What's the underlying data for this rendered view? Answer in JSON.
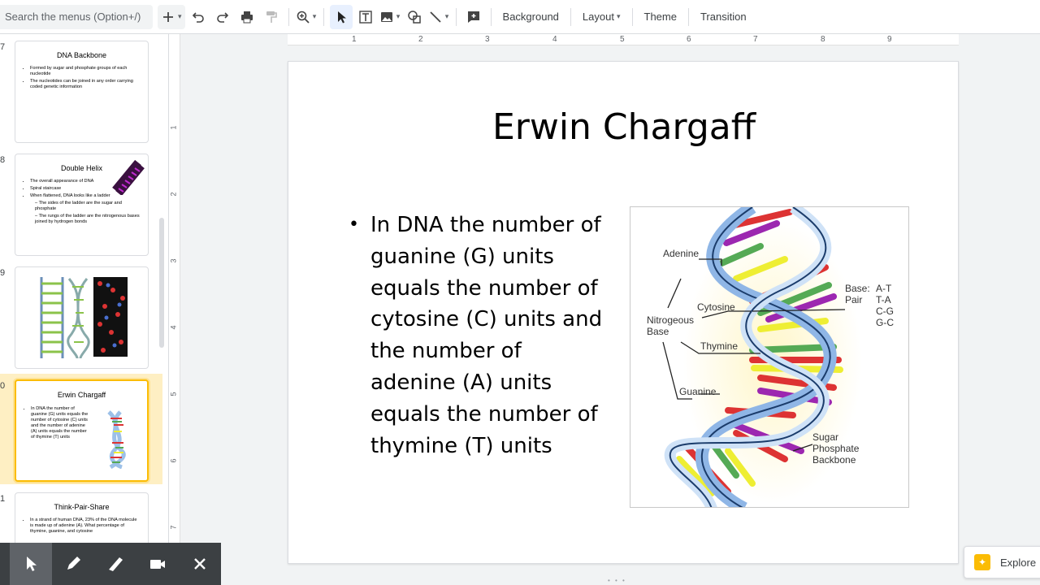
{
  "toolbar": {
    "search_placeholder": "Search the menus (Option+/)",
    "background_label": "Background",
    "layout_label": "Layout",
    "theme_label": "Theme",
    "transition_label": "Transition",
    "caret": "▾"
  },
  "filmstrip": {
    "slides": [
      {
        "num": "7",
        "title": "DNA Backbone",
        "bullets": [
          "Formed by sugar and phosphate groups of each nucleotide",
          "The nucleotides can be joined in any order carrying coded genetic information"
        ]
      },
      {
        "num": "8",
        "title": "Double Helix",
        "bullets": [
          "The overall appearance of DNA",
          "Spiral staircase",
          "When flattened, DNA looks like a ladder"
        ],
        "sub_bullets": [
          "– The sides of the ladder are the sugar and phosphate",
          "– The rungs of the ladder are the nitrogenous bases joined by hydrogen bonds"
        ]
      },
      {
        "num": "9",
        "title": "",
        "bullets": []
      },
      {
        "num": "0",
        "title": "Erwin Chargaff",
        "bullets": [
          "In DNA the number of guanine (G) units equals the number of cytosine (C) units and the number of adenine (A) units equals the number of thymine (T) units"
        ]
      },
      {
        "num": "1",
        "title": "Think-Pair-Share",
        "bullets": [
          "In a strand of human DNA, 23% of the DNA molecule is made up of adenine (A). What percentage of thymine, guanine, and cytosine"
        ]
      }
    ]
  },
  "rulers": {
    "horizontal": [
      "1",
      "2",
      "3",
      "4",
      "5",
      "6",
      "7",
      "8",
      "9"
    ],
    "vertical": [
      "1",
      "2",
      "3",
      "4",
      "5",
      "6",
      "7"
    ]
  },
  "slide": {
    "title": "Erwin Chargaff",
    "bullet_glyph": "•",
    "body": "In DNA the number of guanine (G) units equals the number of cytosine (C) units and the number of adenine (A) units equals the number of thymine (T) units",
    "image_labels": {
      "adenine": "Adenine",
      "nitrogeous_base_line1": "Nitrogeous",
      "nitrogeous_base_line2": "Base",
      "cytosine": "Cytosine",
      "thymine": "Thymine",
      "guanine": "Guanine",
      "base_pair_line1": "Base:",
      "base_pair_line2": "Pair",
      "pairs": [
        "A-T",
        "T-A",
        "C-G",
        "G-C"
      ],
      "backbone_line1": "Sugar",
      "backbone_line2": "Phosphate",
      "backbone_line3": "Backbone"
    }
  },
  "explore_label": "Explore",
  "colors": {
    "accent": "#fbbc04",
    "selection_bg": "#feefc3",
    "presenter_bar": "#3c4043"
  }
}
